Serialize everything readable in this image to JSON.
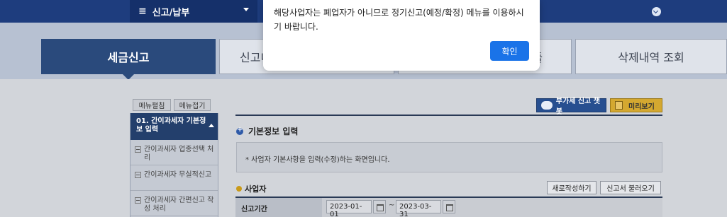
{
  "topbar": {
    "menu_label": "신고/납부",
    "hamburger_glyph": "≡"
  },
  "tabs": [
    {
      "label": "세금신고"
    },
    {
      "label": "신고내"
    },
    {
      "label": ""
    },
    {
      "label": "삭제내역 조회"
    }
  ],
  "tab_partial_suffix": "들",
  "left_nav": {
    "edit_button": "메뉴펼침",
    "collapse_button": "메뉴접기",
    "section_title": "01. 간이과세자 기본정보 입력",
    "items": [
      {
        "label": "간이과세자 업종선택 처리"
      },
      {
        "label": "간이과세자 무실적신고"
      },
      {
        "label": "간이과세자 간편신고 작성 처리"
      }
    ]
  },
  "toolbar": {
    "chatbot_label": "부가세 신고 챗봇",
    "preview_label": "미리보기"
  },
  "main": {
    "section_title": "기본정보 입력",
    "info_text": "* 사업자 기본사항을 입력(수정)하는 화면입니다.",
    "subsection_title": "사업자",
    "new_button": "새로작성하기",
    "load_button": "신고서 불러오기",
    "period_label": "신고기간",
    "date_from": "2023-01-01",
    "tilde": "~",
    "date_to": "2023-03-31"
  },
  "modal": {
    "message": "해당사업자는 폐업자가 아니므로 정기신고(예정/확정) 메뉴를 이용하시기 바랍니다.",
    "ok_label": "확인"
  },
  "colors": {
    "accent": "#1a73e8",
    "nav": "#1e3d7e",
    "active_tab": "#2a4a7c"
  }
}
